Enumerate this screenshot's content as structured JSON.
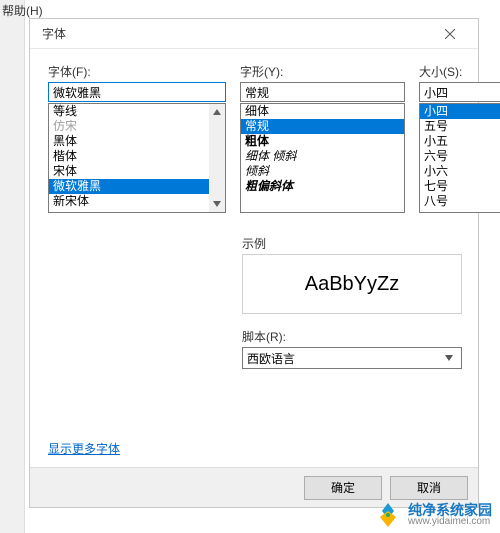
{
  "menu": {
    "help": "帮助(H)"
  },
  "dialog": {
    "title": "字体",
    "font_label": "字体(F):",
    "font_value": "微软雅黑",
    "font_list": [
      {
        "text": "等线",
        "cls": ""
      },
      {
        "text": "仿宋",
        "cls": "faint"
      },
      {
        "text": "黑体",
        "cls": ""
      },
      {
        "text": "楷体",
        "cls": ""
      },
      {
        "text": "宋体",
        "cls": ""
      },
      {
        "text": "微软雅黑",
        "cls": "sel"
      },
      {
        "text": "新宋体",
        "cls": ""
      }
    ],
    "style_label": "字形(Y):",
    "style_value": "常规",
    "style_list": [
      {
        "text": "细体",
        "cls": ""
      },
      {
        "text": "常规",
        "cls": "sel"
      },
      {
        "text": "粗体",
        "cls": "bold"
      },
      {
        "text": "细体 倾斜",
        "cls": "italic"
      },
      {
        "text": "倾斜",
        "cls": "italic"
      },
      {
        "text": "粗偏斜体",
        "cls": "bolditalic"
      }
    ],
    "size_label": "大小(S):",
    "size_value": "小四",
    "size_list": [
      {
        "text": "小四",
        "cls": "sel"
      },
      {
        "text": "五号",
        "cls": ""
      },
      {
        "text": "小五",
        "cls": ""
      },
      {
        "text": "六号",
        "cls": ""
      },
      {
        "text": "小六",
        "cls": ""
      },
      {
        "text": "七号",
        "cls": ""
      },
      {
        "text": "八号",
        "cls": ""
      }
    ],
    "sample_label": "示例",
    "sample_text": "AaBbYyZz",
    "script_label": "脚本(R):",
    "script_value": "西欧语言",
    "more_fonts": "显示更多字体",
    "ok": "确定",
    "cancel": "取消"
  },
  "watermark": {
    "cn": "纯净系统家园",
    "url": "www.yidaimei.com"
  }
}
